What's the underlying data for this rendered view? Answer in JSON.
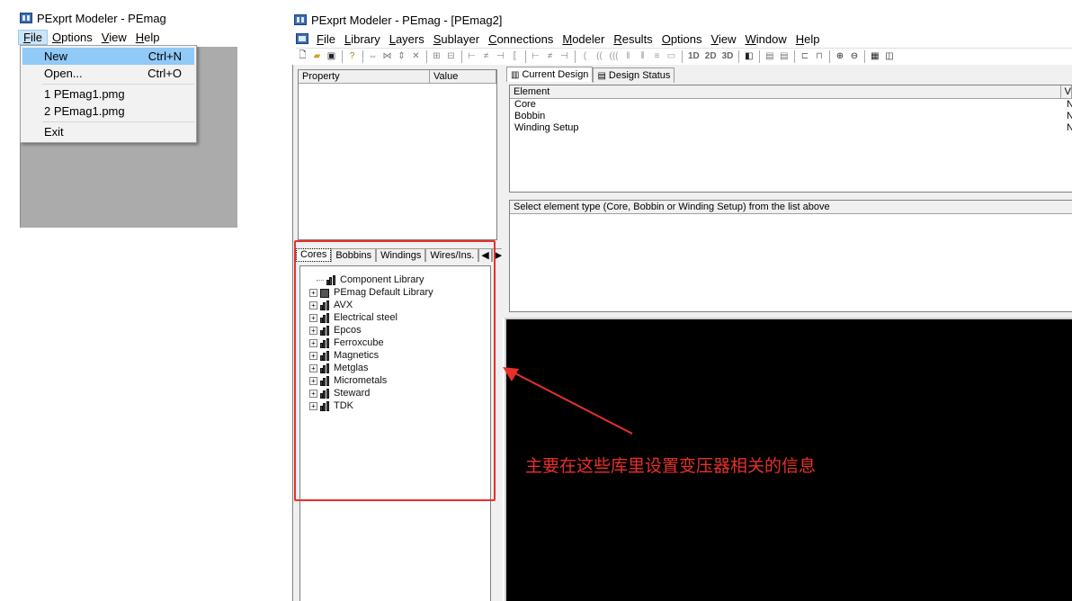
{
  "mini_window": {
    "title": "PExprt Modeler - PEmag",
    "menu": [
      "File",
      "Options",
      "View",
      "Help"
    ],
    "toolbar_glyphs": [
      "|+",
      "*="
    ],
    "file_menu": {
      "new": {
        "label": "New",
        "shortcut": "Ctrl+N"
      },
      "open": {
        "label": "Open...",
        "shortcut": "Ctrl+O"
      },
      "recent1": "1 PEmag1.pmg",
      "recent2": "2 PEmag1.pmg",
      "exit": "Exit"
    }
  },
  "main_window": {
    "title": "PExprt Modeler - PEmag - [PEmag2]",
    "menu": [
      "File",
      "Library",
      "Layers",
      "Sublayer",
      "Connections",
      "Modeler",
      "Results",
      "Options",
      "View",
      "Window",
      "Help"
    ],
    "toolbar_labels": [
      "1D",
      "2D",
      "3D"
    ],
    "property_panel": {
      "col_property": "Property",
      "col_value": "Value"
    },
    "library_tabs": [
      "Cores",
      "Bobbins",
      "Windings",
      "Wires/Ins."
    ],
    "tree": {
      "root": "Component Library",
      "items": [
        "PEmag Default Library",
        "AVX",
        "Electrical steel",
        "Epcos",
        "Ferroxcube",
        "Magnetics",
        "Metglas",
        "Micrometals",
        "Steward",
        "TDK"
      ]
    },
    "design_tabs": [
      "Current Design",
      "Design Status"
    ],
    "element_table": {
      "col_element": "Element",
      "col_value_truncated": "V",
      "rows": [
        {
          "element": "Core",
          "value": "N"
        },
        {
          "element": "Bobbin",
          "value": "N"
        },
        {
          "element": "Winding Setup",
          "value": "N"
        }
      ]
    },
    "hint_text": "Select element type (Core, Bobbin or Winding Setup) from the list above"
  },
  "annotation": {
    "text": "主要在这些库里设置变压器相关的信息",
    "color": "#e8302a"
  }
}
